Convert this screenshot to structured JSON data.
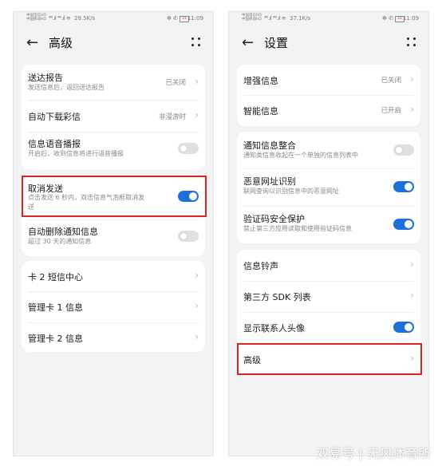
{
  "left": {
    "status": {
      "carrier1": "中国电信HD",
      "carrier2": "中国移动HD",
      "signal": "⁴⁶.ıl ⁴⁶.ıl ≋",
      "speed": "29.5K/s",
      "icons": "✻ ✆",
      "battery": "31",
      "time": "11:09"
    },
    "title": "高级",
    "card1": [
      {
        "label": "送达报告",
        "sub": "发送信息后，返回送达报告",
        "value": "已关闭"
      },
      {
        "label": "自动下载彩信",
        "value": "非漫游时"
      },
      {
        "label": "信息语音播报",
        "sub": "开启后，收到信息将进行语音播报",
        "toggle": "off"
      }
    ],
    "card2": [
      {
        "label": "取消发送",
        "sub1": "点击发送 6 秒内，双击信息气泡框取消发",
        "sub2": "送",
        "toggle": "on"
      },
      {
        "label": "自动删除通知信息",
        "sub": "超过 30 天的通知信息",
        "toggle": "off"
      }
    ],
    "card3": [
      {
        "label": "卡 2 短信中心"
      },
      {
        "label": "管理卡 1 信息"
      },
      {
        "label": "管理卡 2 信息"
      }
    ]
  },
  "right": {
    "status": {
      "carrier1": "中国电信HD",
      "carrier2": "中国移动HD",
      "signal": "⁴⁶.ıl ⁴⁶.ıl ≋",
      "speed": "37.1K/s",
      "icons": "✻ ✆",
      "battery": "31",
      "time": "11:09"
    },
    "title": "设置",
    "card1": [
      {
        "label": "增强信息",
        "value": "已关闭"
      },
      {
        "label": "智能信息",
        "value": "已开启"
      }
    ],
    "card2": [
      {
        "label": "通知信息整合",
        "sub": "通知类信息收起在一个单独的信息列表中",
        "toggle": "off"
      },
      {
        "label": "恶意网址识别",
        "sub": "联网查询以识别信息中的恶意网址",
        "toggle": "on"
      },
      {
        "label": "验证码安全保护",
        "sub": "禁止第三方应用读取和使用验证码信息",
        "toggle": "on"
      }
    ],
    "card3": [
      {
        "label": "信息铃声"
      },
      {
        "label": "第三方 SDK 列表"
      },
      {
        "label": "显示联系人头像",
        "toggle": "on"
      },
      {
        "label": "高级"
      }
    ]
  },
  "watermark": "双易号 | 无风体育所",
  "colors": {
    "accent": "#1f6fdb",
    "highlight": "#dd2222",
    "background": "#f1f3f5"
  },
  "icons": {
    "back": "arrow-left-icon",
    "more": "more-dots-icon",
    "chevron": "chevron-right-icon"
  }
}
